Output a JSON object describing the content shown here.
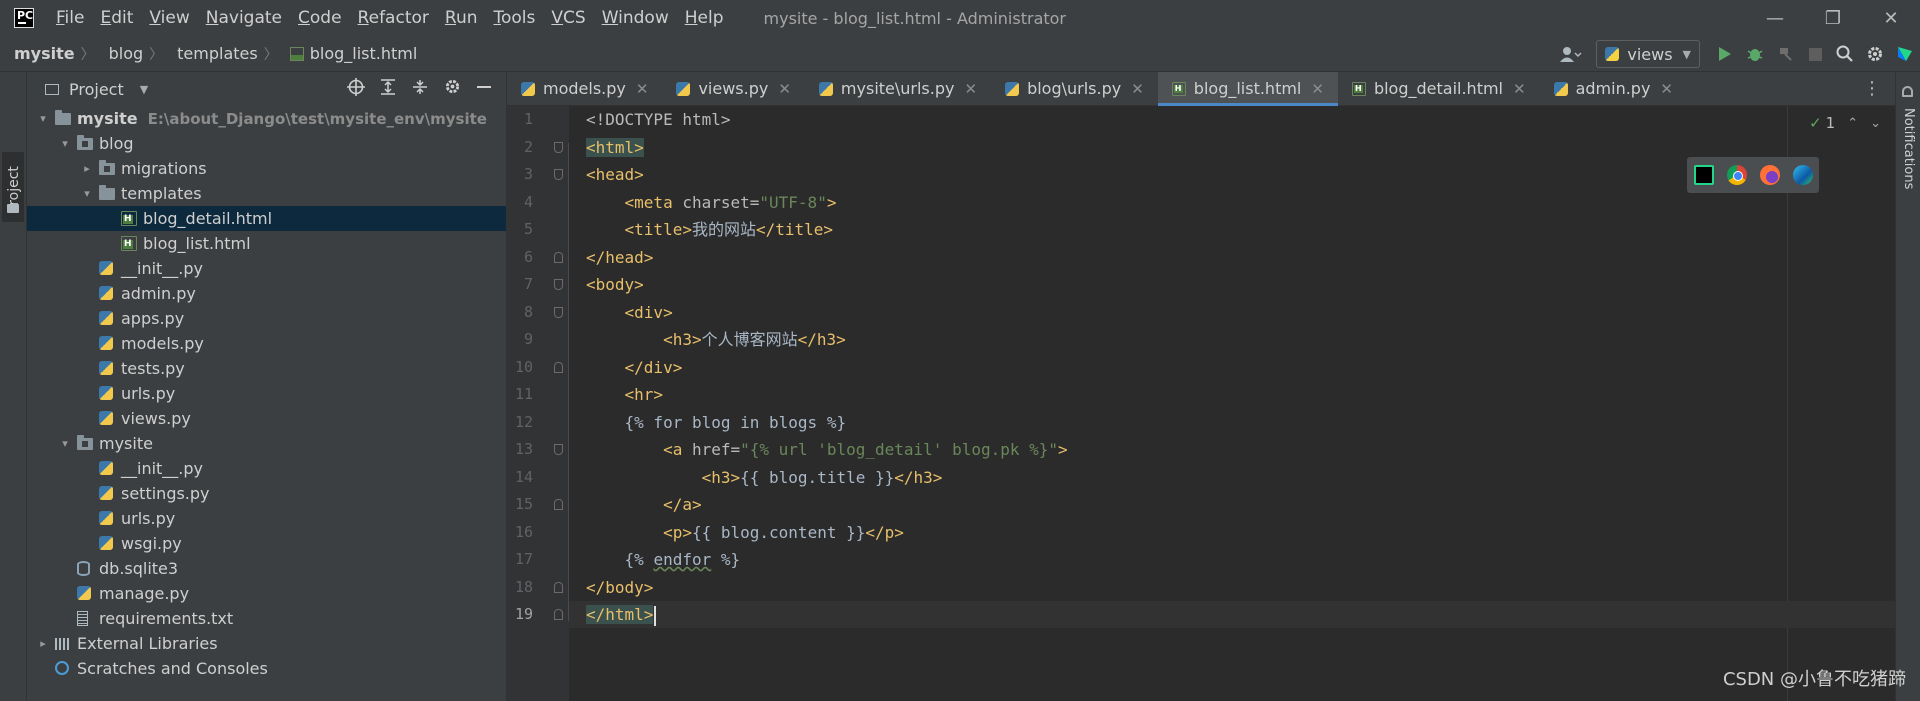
{
  "titlebar": {
    "menu": [
      "File",
      "Edit",
      "View",
      "Navigate",
      "Code",
      "Refactor",
      "Run",
      "Tools",
      "VCS",
      "Window",
      "Help"
    ],
    "window_title": "mysite - blog_list.html - Administrator",
    "controls": {
      "minimize": "—",
      "restore": "❐",
      "close": "✕"
    }
  },
  "breadcrumb": [
    "mysite",
    "blog",
    "templates",
    "blog_list.html"
  ],
  "toolbar": {
    "run_config": "views",
    "run_config_arrow": "▼"
  },
  "left_stripe": {
    "project_label": "Project"
  },
  "project_panel": {
    "title": "Project",
    "dropdown": "▼",
    "tree": [
      {
        "label": "mysite",
        "path": "E:\\about_Django\\test\\mysite_env\\mysite",
        "depth": 0,
        "arrow": "▾",
        "icon": "folder-icon",
        "bold": true
      },
      {
        "label": "blog",
        "depth": 1,
        "arrow": "▾",
        "icon": "module-folder-icon"
      },
      {
        "label": "migrations",
        "depth": 2,
        "arrow": "▸",
        "icon": "module-folder-icon"
      },
      {
        "label": "templates",
        "depth": 2,
        "arrow": "▾",
        "icon": "folder-icon"
      },
      {
        "label": "blog_detail.html",
        "depth": 3,
        "arrow": "",
        "icon": "html-file-icon",
        "selected": true
      },
      {
        "label": "blog_list.html",
        "depth": 3,
        "arrow": "",
        "icon": "html-file-icon"
      },
      {
        "label": "__init__.py",
        "depth": 2,
        "arrow": "",
        "icon": "python-file-icon"
      },
      {
        "label": "admin.py",
        "depth": 2,
        "arrow": "",
        "icon": "python-file-icon"
      },
      {
        "label": "apps.py",
        "depth": 2,
        "arrow": "",
        "icon": "python-file-icon"
      },
      {
        "label": "models.py",
        "depth": 2,
        "arrow": "",
        "icon": "python-file-icon"
      },
      {
        "label": "tests.py",
        "depth": 2,
        "arrow": "",
        "icon": "python-file-icon"
      },
      {
        "label": "urls.py",
        "depth": 2,
        "arrow": "",
        "icon": "python-file-icon"
      },
      {
        "label": "views.py",
        "depth": 2,
        "arrow": "",
        "icon": "python-file-icon"
      },
      {
        "label": "mysite",
        "depth": 1,
        "arrow": "▾",
        "icon": "module-folder-icon"
      },
      {
        "label": "__init__.py",
        "depth": 2,
        "arrow": "",
        "icon": "python-file-icon"
      },
      {
        "label": "settings.py",
        "depth": 2,
        "arrow": "",
        "icon": "python-file-icon"
      },
      {
        "label": "urls.py",
        "depth": 2,
        "arrow": "",
        "icon": "python-file-icon"
      },
      {
        "label": "wsgi.py",
        "depth": 2,
        "arrow": "",
        "icon": "python-file-icon"
      },
      {
        "label": "db.sqlite3",
        "depth": 1,
        "arrow": "",
        "icon": "database-file-icon"
      },
      {
        "label": "manage.py",
        "depth": 1,
        "arrow": "",
        "icon": "python-file-icon"
      },
      {
        "label": "requirements.txt",
        "depth": 1,
        "arrow": "",
        "icon": "text-file-icon"
      },
      {
        "label": "External Libraries",
        "depth": 0,
        "arrow": "▸",
        "icon": "libraries-icon"
      },
      {
        "label": "Scratches and Consoles",
        "depth": 0,
        "arrow": "",
        "icon": "scratches-icon"
      }
    ]
  },
  "editor": {
    "tabs": [
      {
        "label": "models.py",
        "icon": "py",
        "active": false
      },
      {
        "label": "views.py",
        "icon": "py",
        "active": false
      },
      {
        "label": "mysite\\urls.py",
        "icon": "py",
        "active": false
      },
      {
        "label": "blog\\urls.py",
        "icon": "py",
        "active": false
      },
      {
        "label": "blog_list.html",
        "icon": "html",
        "active": true
      },
      {
        "label": "blog_detail.html",
        "icon": "html",
        "active": false
      },
      {
        "label": "admin.py",
        "icon": "py",
        "active": false
      }
    ],
    "tab_close": "✕",
    "inspection_count": "1",
    "current_line": 19,
    "lines": [
      [
        {
          "t": "<!DOCTYPE html>",
          "c": "attr"
        }
      ],
      [
        {
          "t": "<html>",
          "c": "tag hl"
        }
      ],
      [
        {
          "t": "<head>",
          "c": "tag"
        }
      ],
      [
        {
          "t": "    ",
          "c": ""
        },
        {
          "t": "<meta ",
          "c": "tag"
        },
        {
          "t": "charset=",
          "c": "attr"
        },
        {
          "t": "\"UTF-8\"",
          "c": "val"
        },
        {
          "t": ">",
          "c": "tag"
        }
      ],
      [
        {
          "t": "    ",
          "c": ""
        },
        {
          "t": "<title>",
          "c": "tag"
        },
        {
          "t": "我的网站",
          "c": "cjk"
        },
        {
          "t": "</title>",
          "c": "tag"
        }
      ],
      [
        {
          "t": "</head>",
          "c": "tag"
        }
      ],
      [
        {
          "t": "<body>",
          "c": "tag"
        }
      ],
      [
        {
          "t": "    ",
          "c": ""
        },
        {
          "t": "<div>",
          "c": "tag"
        }
      ],
      [
        {
          "t": "        ",
          "c": ""
        },
        {
          "t": "<h3>",
          "c": "tag"
        },
        {
          "t": "个人博客网站",
          "c": "cjk"
        },
        {
          "t": "</h3>",
          "c": "tag"
        }
      ],
      [
        {
          "t": "    ",
          "c": ""
        },
        {
          "t": "</div>",
          "c": "tag"
        }
      ],
      [
        {
          "t": "    ",
          "c": ""
        },
        {
          "t": "<hr>",
          "c": "tag"
        }
      ],
      [
        {
          "t": "    ",
          "c": ""
        },
        {
          "t": "{% for blog in blogs %}",
          "c": "tpl-text"
        }
      ],
      [
        {
          "t": "        ",
          "c": ""
        },
        {
          "t": "<a ",
          "c": "tag"
        },
        {
          "t": "href=",
          "c": "attr"
        },
        {
          "t": "\"{% url 'blog_detail' blog.pk %}\"",
          "c": "val"
        },
        {
          "t": ">",
          "c": "tag"
        }
      ],
      [
        {
          "t": "            ",
          "c": ""
        },
        {
          "t": "<h3>",
          "c": "tag"
        },
        {
          "t": "{{ blog.title }}",
          "c": "tpl-text"
        },
        {
          "t": "</h3>",
          "c": "tag"
        }
      ],
      [
        {
          "t": "        ",
          "c": ""
        },
        {
          "t": "</a>",
          "c": "tag"
        }
      ],
      [
        {
          "t": "        ",
          "c": ""
        },
        {
          "t": "<p>",
          "c": "tag"
        },
        {
          "t": "{{ blog.content }}",
          "c": "tpl-text"
        },
        {
          "t": "</p>",
          "c": "tag"
        }
      ],
      [
        {
          "t": "    ",
          "c": ""
        },
        {
          "t": "{% ",
          "c": "tpl-text"
        },
        {
          "t": "endfor",
          "c": "tpl-text squiggle"
        },
        {
          "t": " %}",
          "c": "tpl-text"
        }
      ],
      [
        {
          "t": "</body>",
          "c": "tag"
        }
      ],
      [
        {
          "t": "</html>",
          "c": "tag hl"
        },
        {
          "t": "",
          "c": "caret"
        }
      ]
    ]
  },
  "right_stripe": {
    "notifications_label": "Notifications"
  },
  "watermark": "CSDN @小鲁不吃猪蹄"
}
